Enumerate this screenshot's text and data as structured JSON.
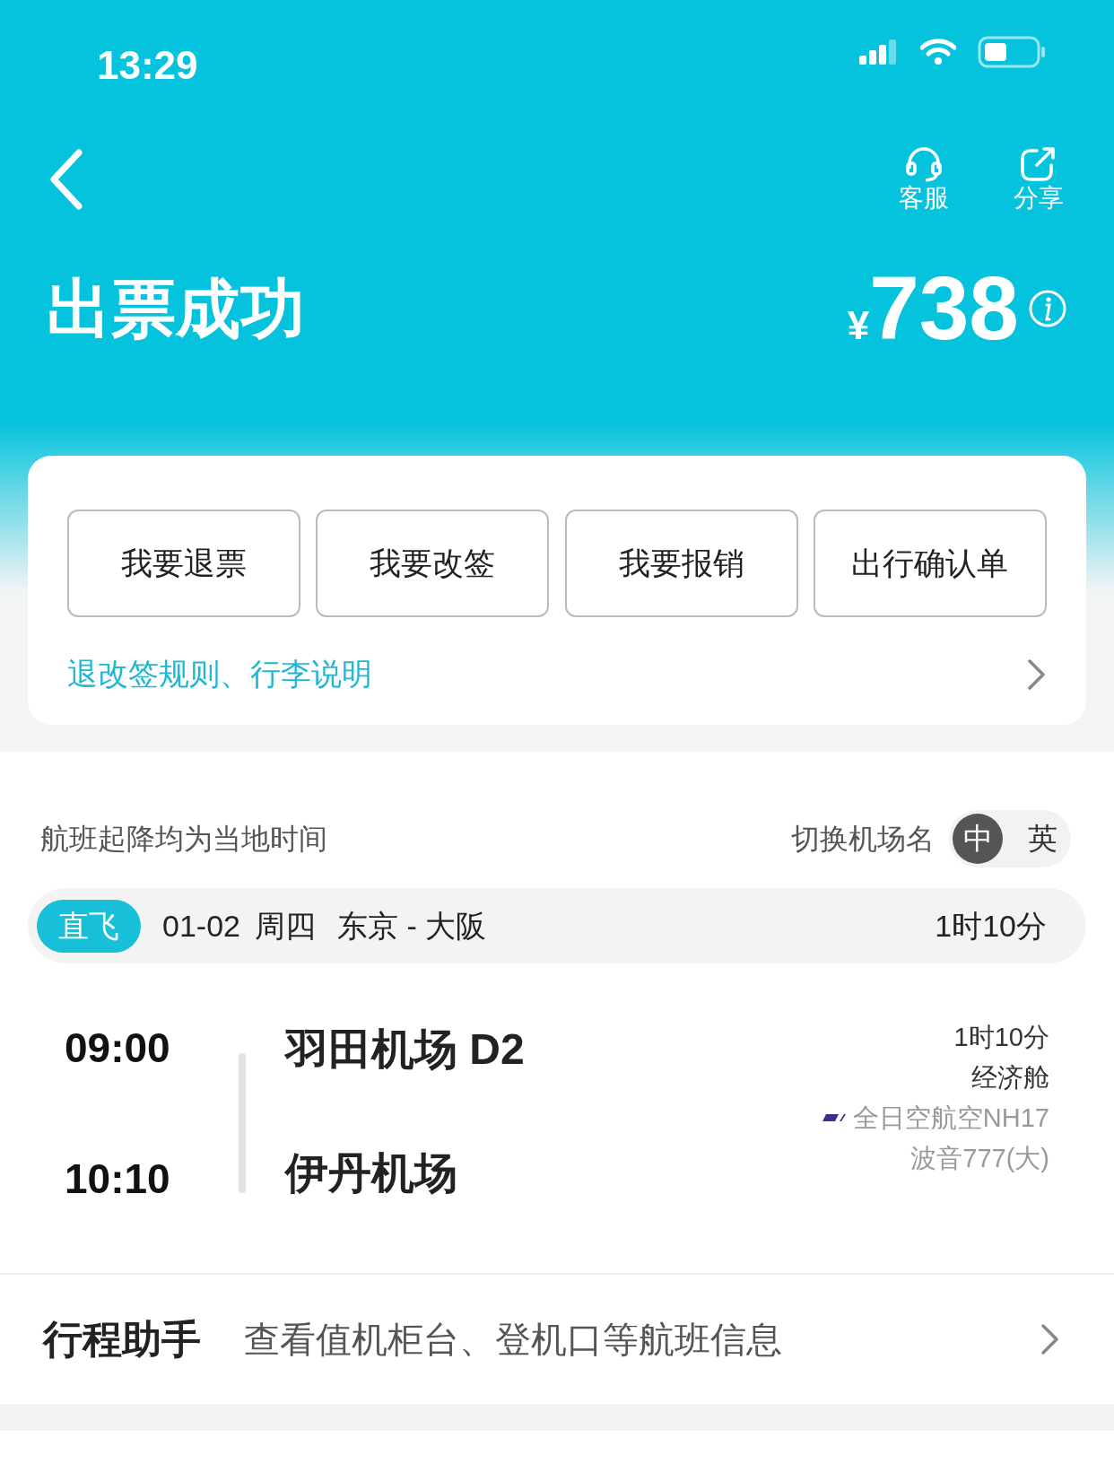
{
  "status_bar": {
    "time": "13:29"
  },
  "nav": {
    "actions": [
      {
        "kind": "support",
        "label": "客服"
      },
      {
        "kind": "share",
        "label": "分享"
      }
    ]
  },
  "header": {
    "title": "出票成功",
    "currency": "¥",
    "price": "738"
  },
  "actions": [
    "我要退票",
    "我要改签",
    "我要报销",
    "出行确认单"
  ],
  "rules_link": "退改签规则、行李说明",
  "time_note": "航班起降均为当地时间",
  "airport_name_toggle": {
    "label": "切换机场名",
    "options": [
      {
        "label": "中",
        "selected": true
      },
      {
        "label": "英",
        "selected": false
      }
    ]
  },
  "flight": {
    "badge": "直飞",
    "date": "01-02",
    "weekday": "周四",
    "route": "东京 - 大阪",
    "duration": "1时10分",
    "departure": {
      "time": "09:00",
      "airport": "羽田机场 D2"
    },
    "arrival": {
      "time": "10:10",
      "airport": "伊丹机场"
    },
    "info": {
      "duration": "1时10分",
      "cabin": "经济舱",
      "airline": "全日空航空NH17",
      "aircraft": "波音777(大)"
    }
  },
  "assistant": {
    "title": "行程助手",
    "text": "查看值机柜台、登机口等航班信息"
  }
}
